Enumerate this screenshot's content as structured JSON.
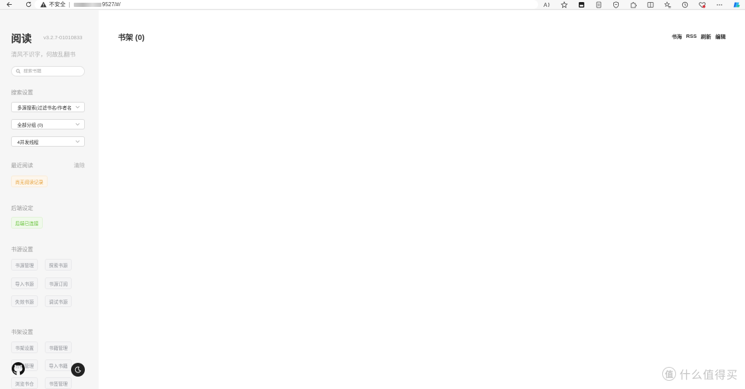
{
  "browser": {
    "security_label": "不安全",
    "url_suffix": "9527/#/"
  },
  "sidebar": {
    "title": "阅读",
    "version": "v3.2.7-01010833",
    "slogan": "清风不识字，何故乱翻书",
    "search_placeholder": "搜索书籍",
    "search_settings_label": "搜索设置",
    "search_mode": "多源搜索(过滤书名/作者名",
    "group_select": "全部分组 (0)",
    "thread_select": "4并发线程",
    "recent_label": "最近阅读",
    "clear_label": "清除",
    "no_history": "尚无阅读记录",
    "backend_label": "后端设定",
    "backend_status": "后端已连接",
    "source_label": "书源设置",
    "source_buttons": [
      "书源管理",
      "探索书源",
      "导入书源",
      "书源订阅",
      "失效书源",
      "调试书源"
    ],
    "shelf_label": "书架设置",
    "shelf_buttons": [
      "书架设置",
      "书籍管理",
      "分组管理",
      "导入书籍",
      "浏览书仓",
      "书签管理"
    ]
  },
  "main": {
    "title": "书架 (0)",
    "actions": [
      "书海",
      "RSS",
      "刷新",
      "编辑"
    ]
  },
  "watermark": {
    "logo_glyph": "值",
    "text": "什么值得买"
  },
  "colors": {
    "warning": "#e6a23c",
    "success": "#67c23a",
    "sidebar_bg": "#f6f6f6"
  }
}
